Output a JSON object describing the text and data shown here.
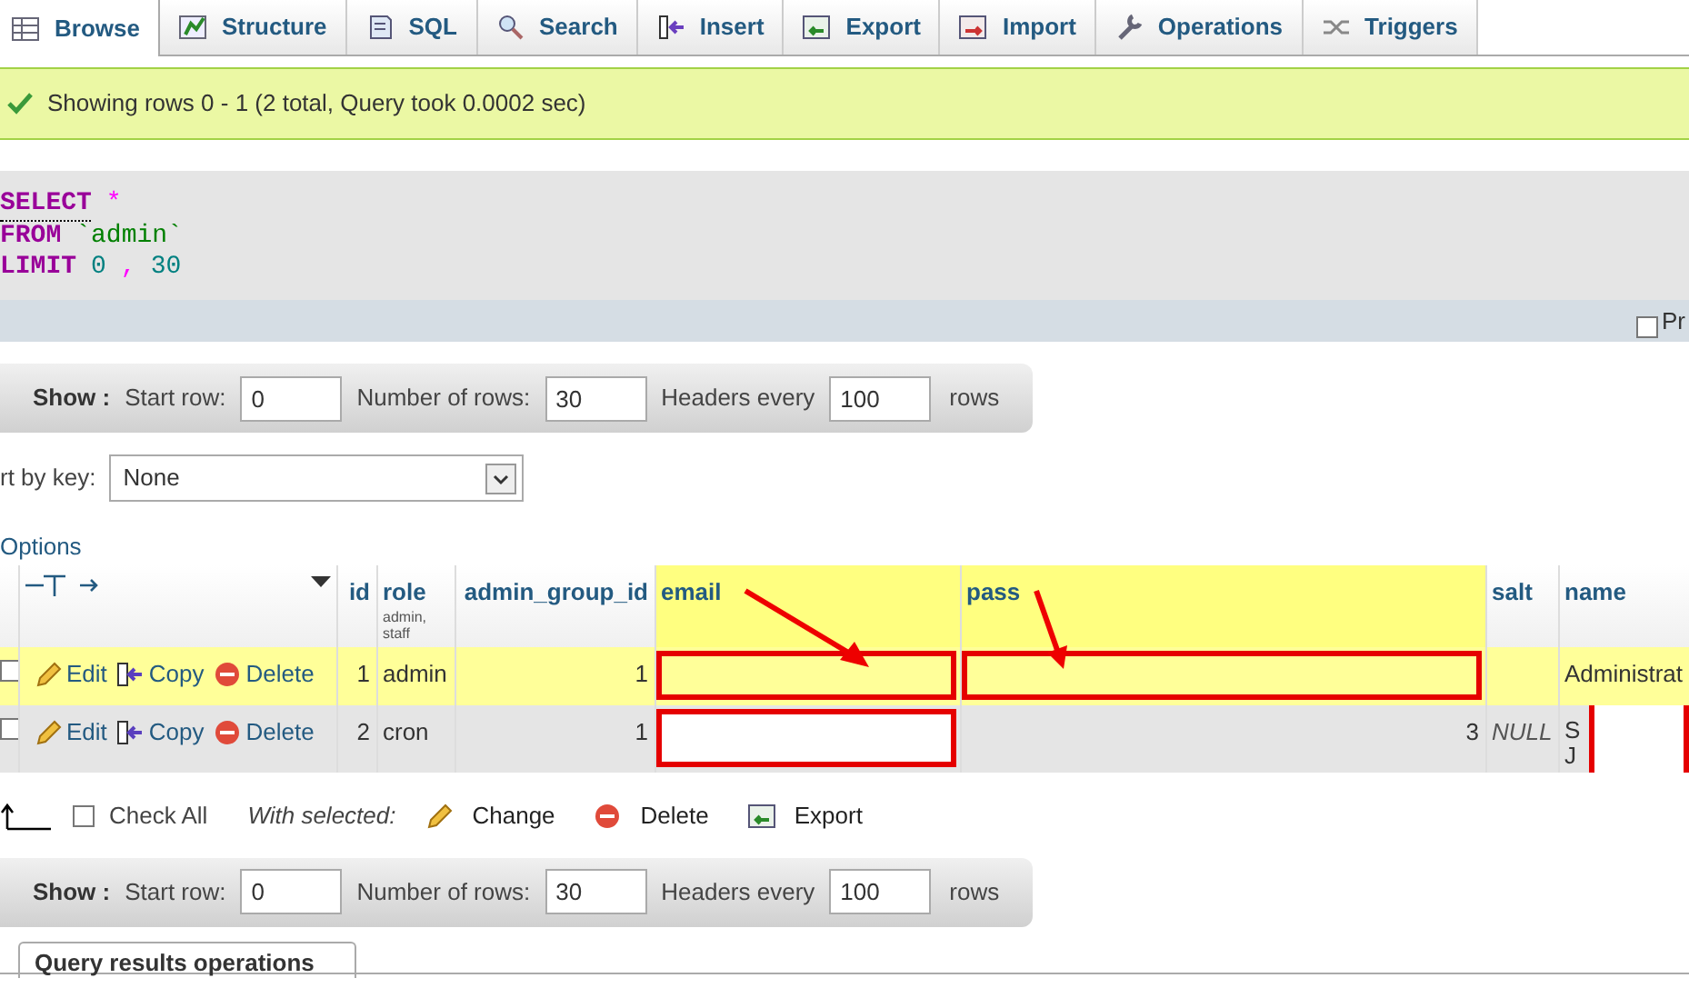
{
  "tabs": [
    {
      "label": "Browse",
      "selected": true
    },
    {
      "label": "Structure",
      "selected": false
    },
    {
      "label": "SQL",
      "selected": false
    },
    {
      "label": "Search",
      "selected": false
    },
    {
      "label": "Insert",
      "selected": false
    },
    {
      "label": "Export",
      "selected": false
    },
    {
      "label": "Import",
      "selected": false
    },
    {
      "label": "Operations",
      "selected": false
    },
    {
      "label": "Triggers",
      "selected": false
    }
  ],
  "message": "Showing rows 0 - 1 (2 total, Query took 0.0002 sec)",
  "sql": [
    [
      {
        "kind": "keyword",
        "text": "SELECT"
      },
      {
        "kind": "punct",
        "text": "*"
      }
    ],
    [
      {
        "kind": "keyword",
        "text": "FROM"
      },
      {
        "kind": "identifier",
        "text": "`admin`"
      }
    ],
    [
      {
        "kind": "keyword",
        "text": "LIMIT"
      },
      {
        "kind": "number",
        "text": "0"
      },
      {
        "kind": "punct",
        "text": ","
      },
      {
        "kind": "number",
        "text": "30"
      }
    ]
  ],
  "profiling": {
    "label": "Pr",
    "checked": false
  },
  "nav_top": {
    "show": "Show :",
    "start_label": "Start row:",
    "start": "0",
    "rows_label": "Number of rows:",
    "rows": "30",
    "headers_label": "Headers every",
    "headers": "100",
    "suffix": "rows"
  },
  "sort": {
    "label": "rt by key:",
    "value": "None"
  },
  "options": "Options",
  "columns": [
    {
      "label": "id"
    },
    {
      "label": "role",
      "comment": "admin, staff"
    },
    {
      "label": "admin_group_id"
    },
    {
      "label": "email",
      "highlighted": true,
      "arrow": true
    },
    {
      "label": "pass",
      "highlighted": true,
      "arrow": true
    },
    {
      "label": "salt"
    },
    {
      "label": "name"
    }
  ],
  "rows": [
    {
      "highlighted": true,
      "checked": false,
      "actions": [
        {
          "kind": "edit",
          "label": "Edit"
        },
        {
          "kind": "copy",
          "label": "Copy"
        },
        {
          "kind": "delete",
          "label": "Delete"
        }
      ],
      "cells": [
        {
          "text": "1"
        },
        {
          "text": "admin"
        },
        {
          "text": "1"
        },
        {
          "redacted": true
        },
        {
          "redacted": true
        },
        {},
        {
          "text": "Administrat"
        }
      ]
    },
    {
      "highlighted": false,
      "checked": false,
      "actions": [
        {
          "kind": "edit",
          "label": "Edit"
        },
        {
          "kind": "copy",
          "label": "Copy"
        },
        {
          "kind": "delete",
          "label": "Delete"
        }
      ],
      "cells": [
        {
          "text": "2"
        },
        {
          "text": "cron"
        },
        {
          "text": "1"
        },
        {
          "redacted": true
        },
        {
          "text": "3"
        },
        {
          "text": "NULL",
          "kind": "null"
        },
        {
          "lines": [
            "S",
            "J"
          ],
          "redacted": true
        }
      ]
    }
  ],
  "bulk": {
    "check_all": "Check All",
    "checked": false,
    "with_selected": "With selected:",
    "actions": [
      {
        "kind": "edit",
        "label": "Change"
      },
      {
        "kind": "delete",
        "label": "Delete"
      },
      {
        "kind": "export",
        "label": "Export"
      }
    ]
  },
  "nav_bottom": {
    "show": "Show :",
    "start_label": "Start row:",
    "start": "0",
    "rows_label": "Number of rows:",
    "rows": "30",
    "headers_label": "Headers every",
    "headers": "100",
    "suffix": "rows"
  },
  "operations_tab": "Query results operations"
}
